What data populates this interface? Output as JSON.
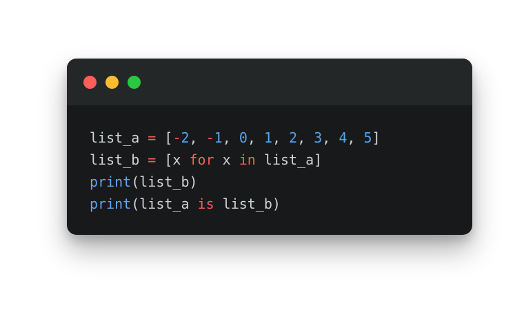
{
  "window": {
    "colors": {
      "background": "#17191a",
      "titlebar": "#242728",
      "text": "#cfd3d6",
      "keyword": "#f0605e",
      "number": "#56a3f0",
      "builtin": "#60a6f2"
    },
    "traffic_lights": [
      {
        "name": "close-button",
        "color": "#fe5f57"
      },
      {
        "name": "minimize-button",
        "color": "#febc2e"
      },
      {
        "name": "maximize-button",
        "color": "#28c840"
      }
    ]
  },
  "code": {
    "lines": [
      [
        {
          "t": "list_a ",
          "k": "plain"
        },
        {
          "t": "=",
          "k": "operator"
        },
        {
          "t": " [",
          "k": "plain"
        },
        {
          "t": "-",
          "k": "operator"
        },
        {
          "t": "2",
          "k": "number"
        },
        {
          "t": ", ",
          "k": "plain"
        },
        {
          "t": "-",
          "k": "operator"
        },
        {
          "t": "1",
          "k": "number"
        },
        {
          "t": ", ",
          "k": "plain"
        },
        {
          "t": "0",
          "k": "number"
        },
        {
          "t": ", ",
          "k": "plain"
        },
        {
          "t": "1",
          "k": "number"
        },
        {
          "t": ", ",
          "k": "plain"
        },
        {
          "t": "2",
          "k": "number"
        },
        {
          "t": ", ",
          "k": "plain"
        },
        {
          "t": "3",
          "k": "number"
        },
        {
          "t": ", ",
          "k": "plain"
        },
        {
          "t": "4",
          "k": "number"
        },
        {
          "t": ", ",
          "k": "plain"
        },
        {
          "t": "5",
          "k": "number"
        },
        {
          "t": "]",
          "k": "plain"
        }
      ],
      [
        {
          "t": "list_b ",
          "k": "plain"
        },
        {
          "t": "=",
          "k": "operator"
        },
        {
          "t": " [x ",
          "k": "plain"
        },
        {
          "t": "for",
          "k": "keyword"
        },
        {
          "t": " x ",
          "k": "plain"
        },
        {
          "t": "in",
          "k": "keyword"
        },
        {
          "t": " list_a]",
          "k": "plain"
        }
      ],
      [
        {
          "t": "print",
          "k": "builtin"
        },
        {
          "t": "(list_b)",
          "k": "plain"
        }
      ],
      [
        {
          "t": "print",
          "k": "builtin"
        },
        {
          "t": "(list_a ",
          "k": "plain"
        },
        {
          "t": "is",
          "k": "keyword"
        },
        {
          "t": " list_b)",
          "k": "plain"
        }
      ]
    ]
  }
}
